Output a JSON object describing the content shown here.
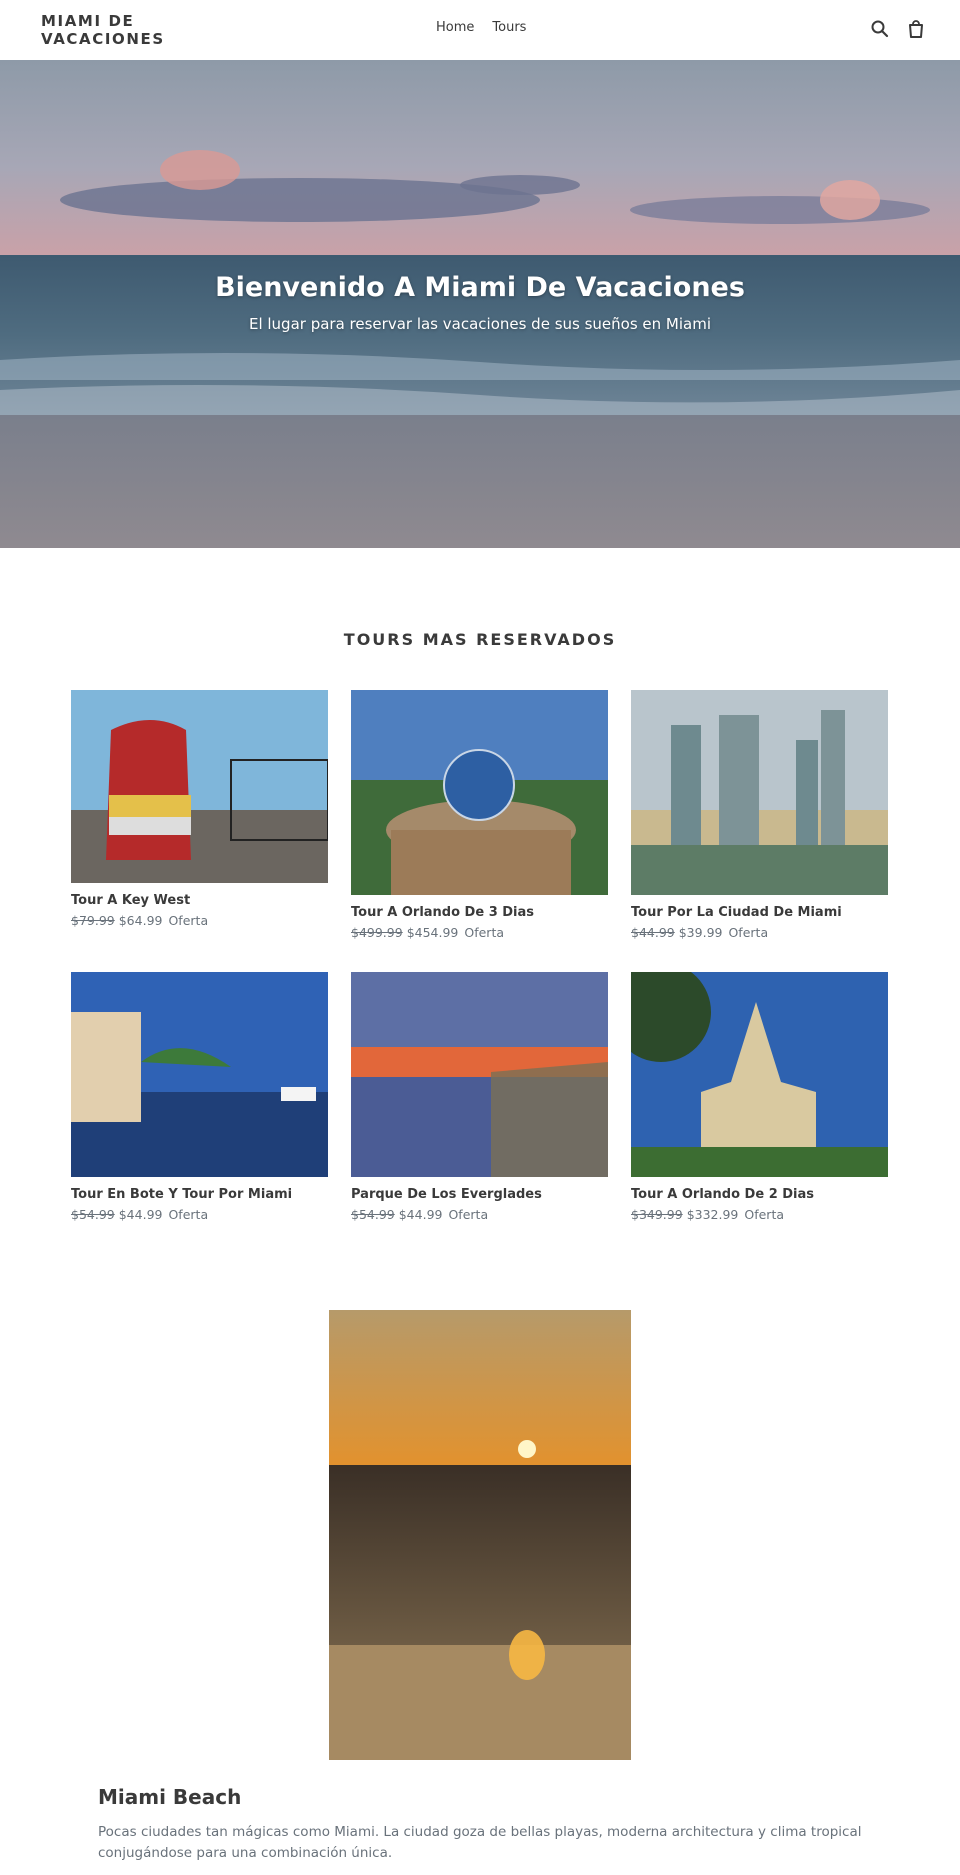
{
  "header": {
    "logo": "MIAMI DE VACACIONES",
    "nav": [
      {
        "label": "Home"
      },
      {
        "label": "Tours"
      }
    ],
    "icons": {
      "search": "search-icon",
      "cart": "cart-icon"
    }
  },
  "hero": {
    "title": "Bienvenido A Miami De Vacaciones",
    "subtitle": "El lugar para reservar las vacaciones de sus sueños en Miami"
  },
  "collection": {
    "title": "TOURS MAS RESERVADOS",
    "products": [
      {
        "title": "Tour A Key West",
        "price_regular": "$79.99",
        "price_sale": "$64.99",
        "badge": "Oferta"
      },
      {
        "title": "Tour A Orlando De 3 Dias",
        "price_regular": "$499.99",
        "price_sale": "$454.99",
        "badge": "Oferta"
      },
      {
        "title": "Tour Por La Ciudad De Miami",
        "price_regular": "$44.99",
        "price_sale": "$39.99",
        "badge": "Oferta"
      },
      {
        "title": "Tour En Bote Y Tour Por Miami",
        "price_regular": "$54.99",
        "price_sale": "$44.99",
        "badge": "Oferta"
      },
      {
        "title": "Parque De Los Everglades",
        "price_regular": "$54.99",
        "price_sale": "$44.99",
        "badge": "Oferta"
      },
      {
        "title": "Tour A Orlando De 2 Dias",
        "price_regular": "$349.99",
        "price_sale": "$332.99",
        "badge": "Oferta"
      }
    ]
  },
  "feature": {
    "title": "Miami Beach",
    "text": "Pocas ciudades tan mágicas como Miami. La ciudad goza de bellas playas, moderna architectura y clima tropical conjugándose para una combinación única."
  },
  "colors": {
    "text": "#3a3a3a",
    "muted": "#69727b",
    "background": "#ffffff"
  }
}
